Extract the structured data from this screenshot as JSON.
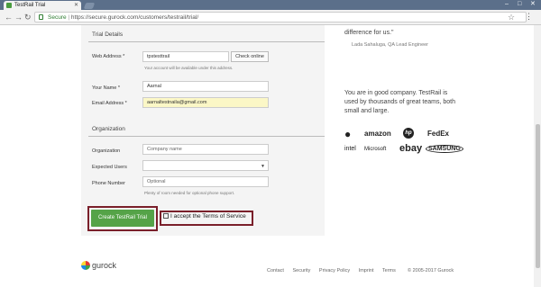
{
  "browser": {
    "tab_title": "TestRail Trial",
    "url_secure": "Secure",
    "url": "https://secure.gurock.com/customers/testrail/trial/"
  },
  "trial": {
    "section_title": "Trial Details",
    "web_address_label": "Web Address *",
    "web_address_value": "tpstesttrail",
    "check_button": "Check online",
    "web_address_help": "Your account will be available under this address.",
    "name_label": "Your Name *",
    "name_value": "Aarnal",
    "email_label": "Email Address *",
    "email_value": "aarnaltestnaila@gmail.com"
  },
  "organization": {
    "section_title": "Organization",
    "org_label": "Organization",
    "org_placeholder": "Company name",
    "users_label": "Expected Users",
    "phone_label": "Phone Number",
    "phone_placeholder": "Optional",
    "phone_help": "Plenty of room needed for optional phone support."
  },
  "actions": {
    "create_label": "Create TestRail Trial",
    "tos_label": "I accept the Terms of Service"
  },
  "sidebar": {
    "quote_tail": "difference for us.\"",
    "quote_author": "Lada Sahaluga, QA Lead Engineer",
    "company_text": "You are in good company. TestRail is used by thousands of great teams, both small and large.",
    "logos": [
      "",
      "amazon",
      "hp",
      "FedEx",
      "intel",
      "Microsoft",
      "ebay",
      "SAMSUNG"
    ]
  },
  "footer": {
    "brand": "gurock",
    "links": [
      "Contact",
      "Security",
      "Privacy Policy",
      "Imprint",
      "Terms"
    ],
    "copyright": "© 2005-2017 Gurock"
  }
}
